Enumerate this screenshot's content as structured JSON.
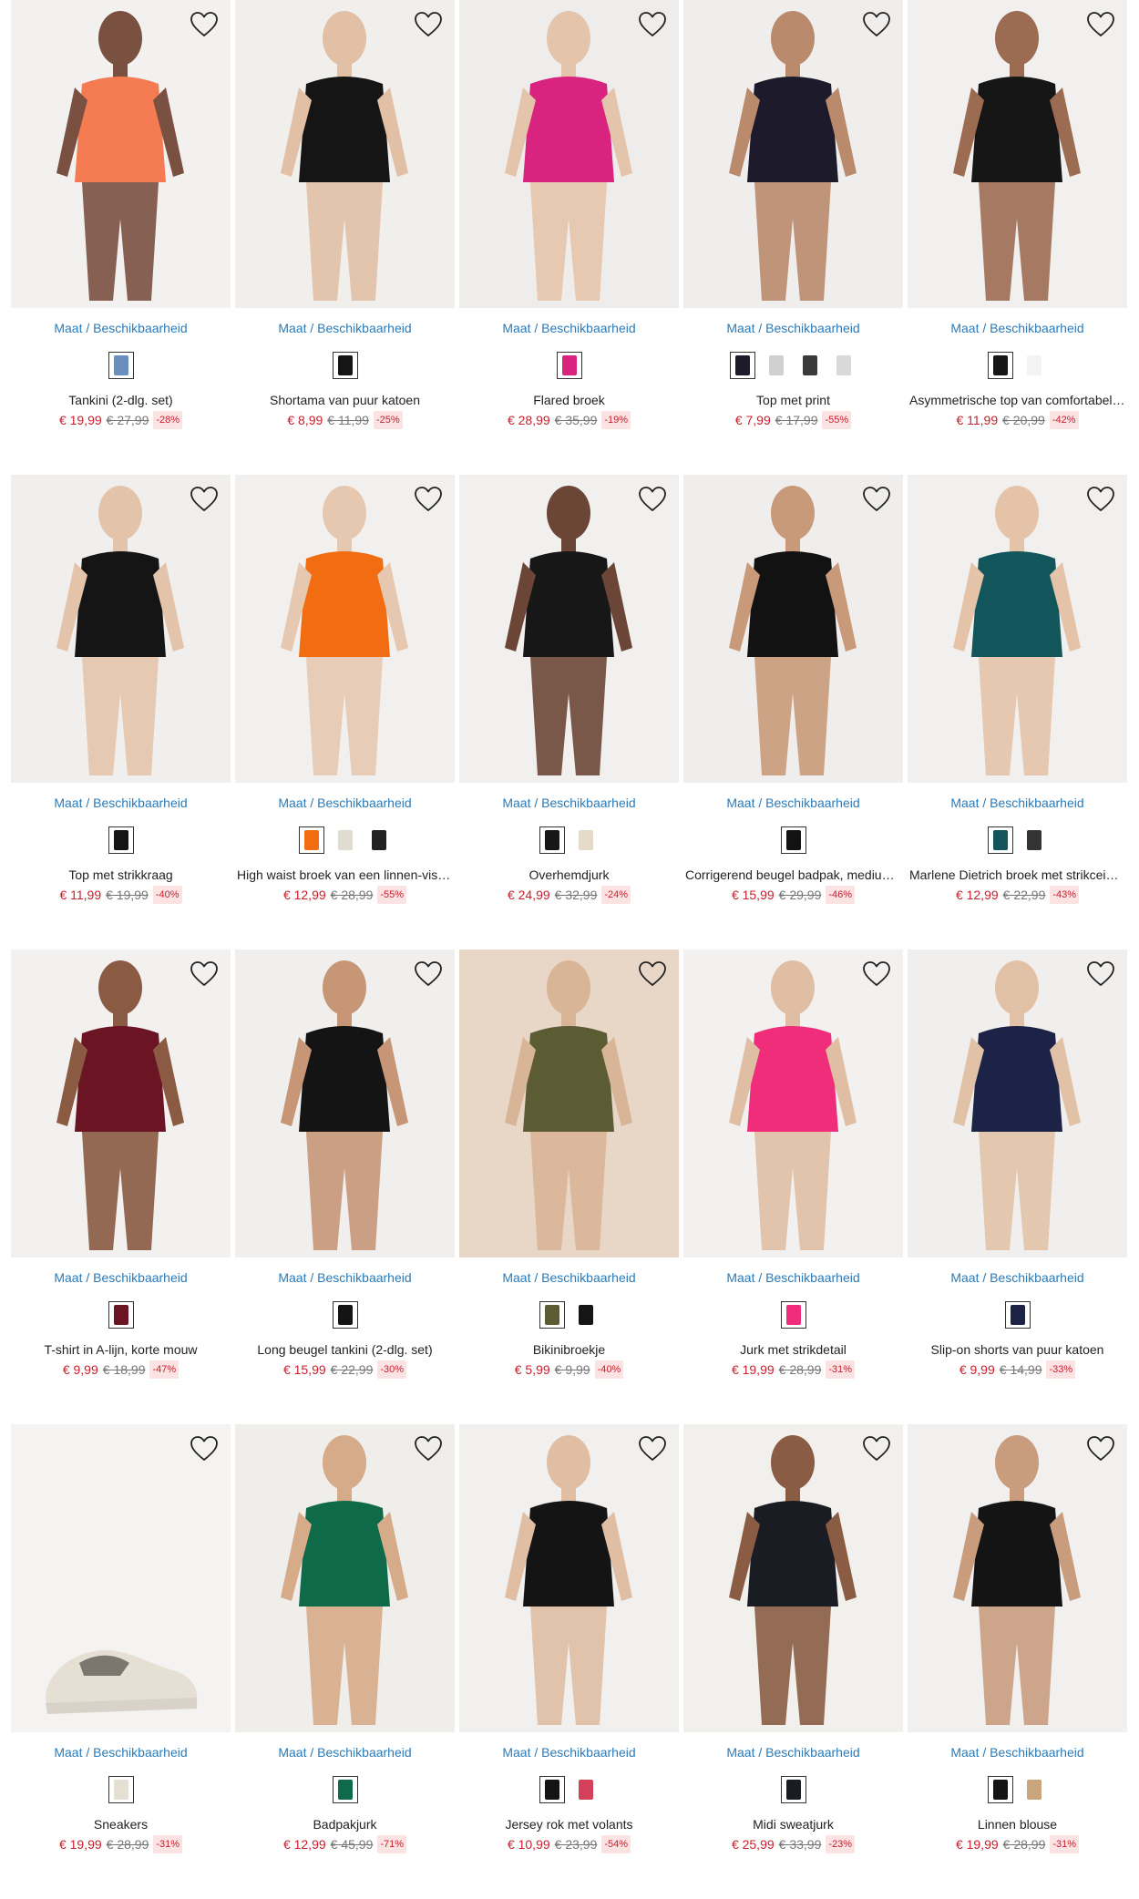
{
  "size_link_label": "Maat / Beschikbaarheid",
  "colors": {
    "link": "#2b7bb9",
    "sale": "#c8202e",
    "badge_bg": "#fbe3e3"
  },
  "products": [
    {
      "title": "Tankini (2-dlg. set)",
      "price": "€ 19,99",
      "was": "€ 27,99",
      "discount": "-28%",
      "bg": "#f2f1ef",
      "fig": "#7a5040",
      "cloth": "#f47b52",
      "swatches": [
        "#6a8fbf"
      ]
    },
    {
      "title": "Shortama van puur katoen",
      "price": "€ 8,99",
      "was": "€ 11,99",
      "discount": "-25%",
      "bg": "#f1efec",
      "fig": "#e1c0a6",
      "cloth": "#151515",
      "swatches": [
        "#151515"
      ]
    },
    {
      "title": "Flared broek",
      "price": "€ 28,99",
      "was": "€ 35,99",
      "discount": "-19%",
      "bg": "#efedeb",
      "fig": "#e4c4aa",
      "cloth": "#d8237f",
      "swatches": [
        "#d8237f"
      ]
    },
    {
      "title": "Top met print",
      "price": "€ 7,99",
      "was": "€ 17,99",
      "discount": "-55%",
      "bg": "#f0eeec",
      "fig": "#b98a6c",
      "cloth": "#1d1a2b",
      "swatches": [
        "#1d1a2b",
        "#cfcfcf",
        "#3a3a3a",
        "#d9d9d9"
      ]
    },
    {
      "title": "Asymmetrische top van comfortabel materiaal",
      "price": "€ 11,99",
      "was": "€ 20,99",
      "discount": "-42%",
      "bg": "#f1f0ee",
      "fig": "#9c6c52",
      "cloth": "#161616",
      "swatches": [
        "#161616",
        "#f3f3f3"
      ]
    },
    {
      "title": "Top met strikkraag",
      "price": "€ 11,99",
      "was": "€ 19,99",
      "discount": "-40%",
      "bg": "#f0efed",
      "fig": "#e3c4ab",
      "cloth": "#151515",
      "swatches": [
        "#151515"
      ]
    },
    {
      "title": "High waist broek van een linnen-viscose mix",
      "price": "€ 12,99",
      "was": "€ 28,99",
      "discount": "-55%",
      "bg": "#f2f0ee",
      "fig": "#e6c8b0",
      "cloth": "#f26c12",
      "swatches": [
        "#f26c12",
        "#e0dccf",
        "#222222"
      ]
    },
    {
      "title": "Overhemdjurk",
      "price": "€ 24,99",
      "was": "€ 32,99",
      "discount": "-24%",
      "bg": "#f1f0ee",
      "fig": "#6b4636",
      "cloth": "#171717",
      "swatches": [
        "#171717",
        "#e5dac6"
      ]
    },
    {
      "title": "Corrigerend beugel badpak, medium shape",
      "price": "€ 15,99",
      "was": "€ 29,99",
      "discount": "-46%",
      "bg": "#efeeec",
      "fig": "#c99a7a",
      "cloth": "#121212",
      "swatches": [
        "#121212"
      ]
    },
    {
      "title": "Marlene Dietrich broek met strikceintuur",
      "price": "€ 12,99",
      "was": "€ 22,99",
      "discount": "-43%",
      "bg": "#f1f0ee",
      "fig": "#e4c3a8",
      "cloth": "#12555a",
      "swatches": [
        "#12555a",
        "#333333"
      ]
    },
    {
      "title": "T-shirt in A-lijn, korte mouw",
      "price": "€ 9,99",
      "was": "€ 18,99",
      "discount": "-47%",
      "bg": "#f2f1ef",
      "fig": "#8a5a42",
      "cloth": "#6b1424",
      "swatches": [
        "#6b1424"
      ]
    },
    {
      "title": "Long beugel tankini (2-dlg. set)",
      "price": "€ 15,99",
      "was": "€ 22,99",
      "discount": "-30%",
      "bg": "#f1efed",
      "fig": "#c69677",
      "cloth": "#141414",
      "swatches": [
        "#141414"
      ]
    },
    {
      "title": "Bikinibroekje",
      "price": "€ 5,99",
      "was": "€ 9,99",
      "discount": "-40%",
      "bg": "#e8d6c6",
      "fig": "#d9b597",
      "cloth": "#5b5c33",
      "swatches": [
        "#5b5c33",
        "#151515"
      ]
    },
    {
      "title": "Jurk met strikdetail",
      "price": "€ 19,99",
      "was": "€ 28,99",
      "discount": "-31%",
      "bg": "#f2f1ef",
      "fig": "#e0bea3",
      "cloth": "#ef2d7a",
      "swatches": [
        "#ef2d7a"
      ]
    },
    {
      "title": "Slip-on shorts van puur katoen",
      "price": "€ 9,99",
      "was": "€ 14,99",
      "discount": "-33%",
      "bg": "#f0efed",
      "fig": "#e2c2a7",
      "cloth": "#1c2346",
      "swatches": [
        "#1c2346"
      ]
    },
    {
      "title": "Sneakers",
      "price": "€ 19,99",
      "was": "€ 28,99",
      "discount": "-31%",
      "bg": "#f4f3f1",
      "fig": "#f4f3f1",
      "cloth": "#e6dfd4",
      "swatches": [
        "#e6dfd4"
      ]
    },
    {
      "title": "Badpakjurk",
      "price": "€ 12,99",
      "was": "€ 45,99",
      "discount": "-71%",
      "bg": "#f0eeeb",
      "fig": "#d6ab8a",
      "cloth": "#0f6a4a",
      "swatches": [
        "#0f6a4a"
      ]
    },
    {
      "title": "Jersey rok met volants",
      "price": "€ 10,99",
      "was": "€ 23,99",
      "discount": "-54%",
      "bg": "#f1f0ee",
      "fig": "#dfbea4",
      "cloth": "#141414",
      "swatches": [
        "#141414",
        "#d2405a"
      ]
    },
    {
      "title": "Midi sweatjurk",
      "price": "€ 25,99",
      "was": "€ 33,99",
      "discount": "-23%",
      "bg": "#f2f0ec",
      "fig": "#8a5c44",
      "cloth": "#1a1c24",
      "swatches": [
        "#1a1c24"
      ]
    },
    {
      "title": "Linnen blouse",
      "price": "€ 19,99",
      "was": "€ 28,99",
      "discount": "-31%",
      "bg": "#f1f0ee",
      "fig": "#c99c7e",
      "cloth": "#141414",
      "swatches": [
        "#141414",
        "#c9a57e"
      ]
    }
  ]
}
